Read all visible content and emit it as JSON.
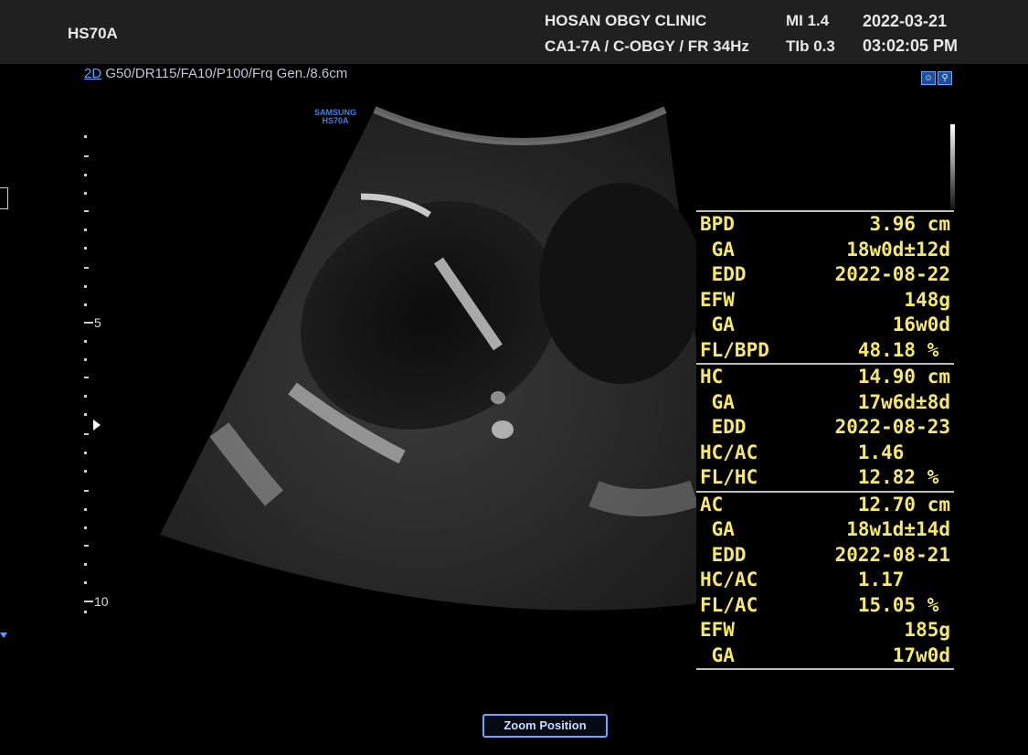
{
  "header": {
    "model": "HS70A",
    "clinic": "HOSAN OBGY CLINIC",
    "probe_preset": "CA1-7A / C-OBGY / FR 34Hz",
    "mi": "MI  1.4",
    "tib": "TIb 0.3",
    "date": "2022-03-21",
    "time": "03:02:05 PM"
  },
  "imaging": {
    "mode": "2D",
    "params": " G50/DR115/FA10/P100/Frq Gen./8.6cm",
    "brand_top": "SAMSUNG",
    "brand_bottom": "HS70A",
    "depth_marker_5": "5",
    "depth_marker_10": "10"
  },
  "measurements": [
    {
      "rows": [
        {
          "label": "BPD",
          "value": "3.96 cm"
        },
        {
          "label": " GA",
          "value": "18w0d±12d"
        },
        {
          "label": " EDD",
          "value": "2022-08-22"
        },
        {
          "label": "EFW",
          "value": "148g"
        },
        {
          "label": " GA",
          "value": "16w0d"
        },
        {
          "label": "FL/BPD",
          "value": "48.18 % "
        }
      ]
    },
    {
      "rows": [
        {
          "label": "HC",
          "value": "14.90 cm"
        },
        {
          "label": " GA",
          "value": "17w6d±8d"
        },
        {
          "label": " EDD",
          "value": "2022-08-23"
        },
        {
          "label": "HC/AC",
          "value": "1.46    "
        },
        {
          "label": "FL/HC",
          "value": "12.82 % "
        }
      ]
    },
    {
      "rows": [
        {
          "label": "AC",
          "value": "12.70 cm"
        },
        {
          "label": " GA",
          "value": "18w1d±14d"
        },
        {
          "label": " EDD",
          "value": "2022-08-21"
        },
        {
          "label": "HC/AC",
          "value": "1.17    "
        },
        {
          "label": "FL/AC",
          "value": "15.05 % "
        },
        {
          "label": "EFW",
          "value": "185g"
        },
        {
          "label": " GA",
          "value": "17w0d"
        }
      ]
    }
  ],
  "controls": {
    "zoom_position": "Zoom Position"
  },
  "colors": {
    "measurement_text": "#f6e86a",
    "accent": "#5aa0ff"
  }
}
